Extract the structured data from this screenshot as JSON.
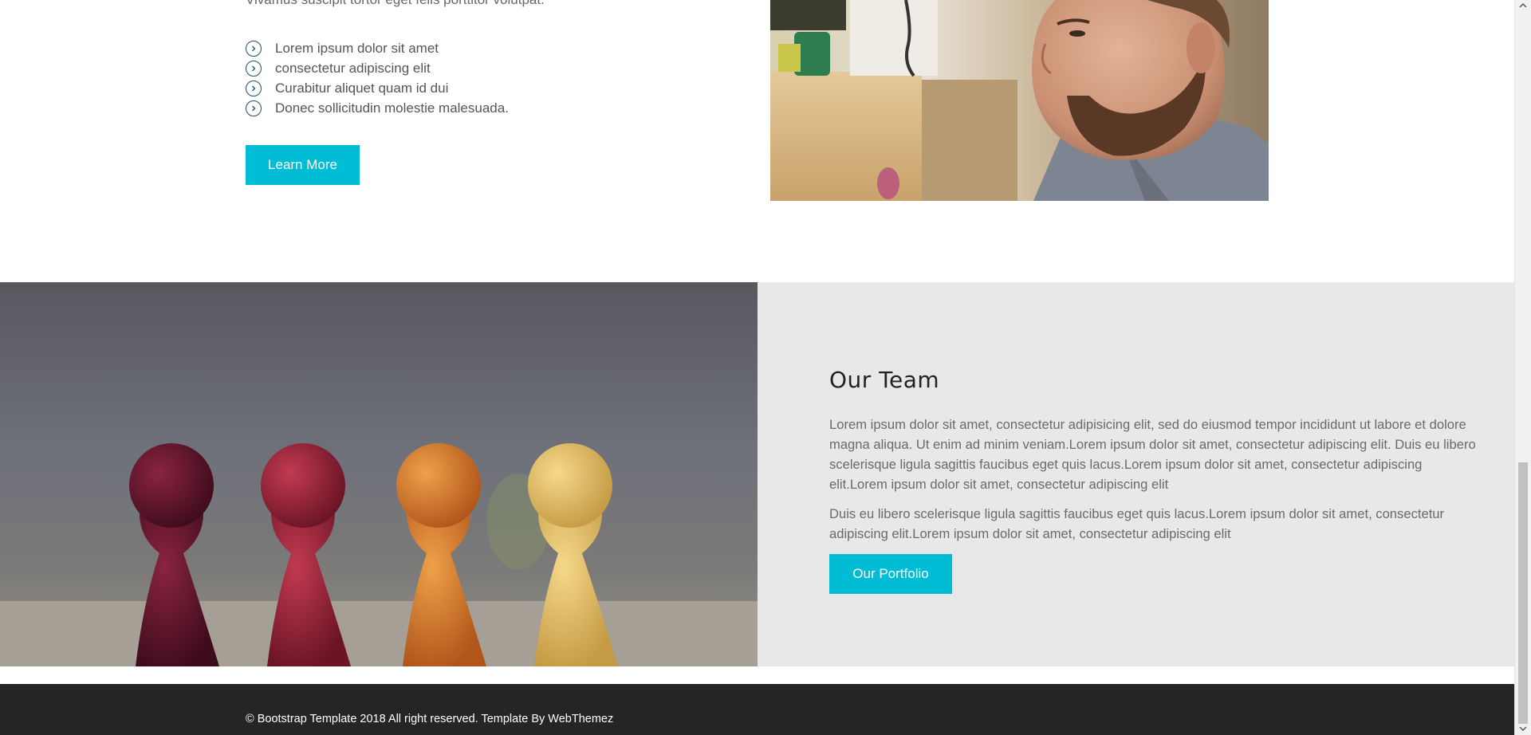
{
  "top": {
    "cut_paragraph": "Vivamus suscipit tortor eget felis porttitor volutpat.",
    "list_items": [
      "Lorem ipsum dolor sit amet",
      "consectetur adipiscing elit",
      "Curabitur aliquet quam id dui",
      "Donec sollicitudin molestie malesuada."
    ],
    "learn_more_label": "Learn More"
  },
  "team": {
    "title": "Our Team",
    "paragraph1": "Lorem ipsum dolor sit amet, consectetur adipisicing elit, sed do eiusmod tempor incididunt ut labore et dolore magna aliqua. Ut enim ad minim veniam.Lorem ipsum dolor sit amet, consectetur adipiscing elit. Duis eu libero scelerisque ligula sagittis faucibus eget quis lacus.Lorem ipsum dolor sit amet, consectetur adipiscing elit.Lorem ipsum dolor sit amet, consectetur adipiscing elit",
    "paragraph2": "Duis eu libero scelerisque ligula sagittis faucibus eget quis lacus.Lorem ipsum dolor sit amet, consectetur adipiscing elit.Lorem ipsum dolor sit amet, consectetur adipiscing elit",
    "portfolio_label": "Our Portfolio"
  },
  "footer": {
    "copyright": "© Bootstrap Template 2018 All right reserved. Template By WebThemez"
  },
  "colors": {
    "accent": "#00bcd4",
    "team_bg": "#e8e8e8",
    "footer_bg": "#252525",
    "icon_outline": "#1d4f6e"
  },
  "icons": {
    "list_bullet": "chevron-right-circle-icon"
  }
}
